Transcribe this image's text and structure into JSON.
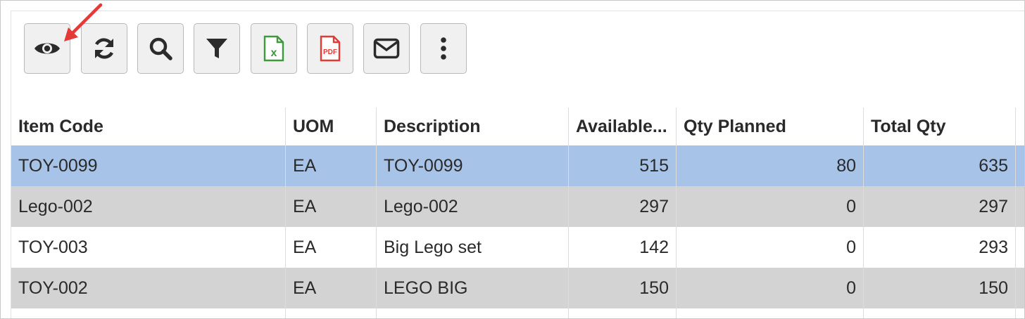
{
  "toolbar": {
    "buttons": [
      {
        "name": "view-columns",
        "icon": "eye-icon"
      },
      {
        "name": "refresh",
        "icon": "refresh-icon"
      },
      {
        "name": "search",
        "icon": "search-icon"
      },
      {
        "name": "filter",
        "icon": "filter-icon"
      },
      {
        "name": "export-excel",
        "icon": "excel-file-icon",
        "icon_text": "X",
        "color": "#3c9a3c"
      },
      {
        "name": "export-pdf",
        "icon": "pdf-file-icon",
        "icon_text": "PDF",
        "color": "#e53935"
      },
      {
        "name": "email",
        "icon": "envelope-icon"
      },
      {
        "name": "more",
        "icon": "kebab-menu-icon"
      }
    ]
  },
  "annotation": {
    "color": "#e53935"
  },
  "table": {
    "headers": [
      "Item Code",
      "UOM",
      "Description",
      "Available...",
      "Qty Planned",
      "Total Qty"
    ],
    "rows": [
      {
        "item_code": "TOY-0099",
        "uom": "EA",
        "description": "TOY-0099",
        "available": "515",
        "qty_planned": "80",
        "total_qty": "635"
      },
      {
        "item_code": "Lego-002",
        "uom": "EA",
        "description": "Lego-002",
        "available": "297",
        "qty_planned": "0",
        "total_qty": "297"
      },
      {
        "item_code": "TOY-003",
        "uom": "EA",
        "description": "Big Lego set",
        "available": "142",
        "qty_planned": "0",
        "total_qty": "293"
      },
      {
        "item_code": "TOY-002",
        "uom": "EA",
        "description": "LEGO BIG",
        "available": "150",
        "qty_planned": "0",
        "total_qty": "150"
      }
    ],
    "selected_row_color": "#a7c3e8",
    "alt_row_color": "#d3d3d3"
  }
}
